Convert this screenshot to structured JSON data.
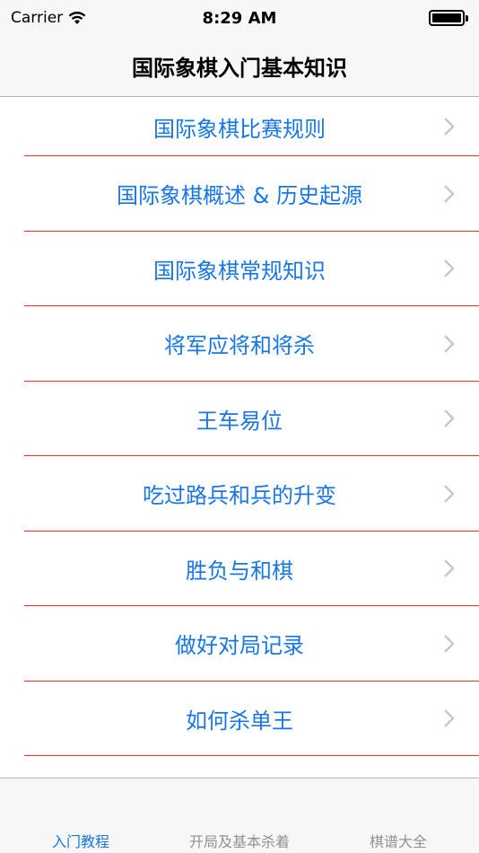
{
  "status_bar": {
    "carrier": "Carrier",
    "time": "8:29 AM"
  },
  "nav": {
    "title": "国际象棋入门基本知识"
  },
  "list": {
    "items": [
      {
        "label": "国际象棋比赛规则"
      },
      {
        "label": "国际象棋概述 & 历史起源"
      },
      {
        "label": "国际象棋常规知识"
      },
      {
        "label": "将军应将和将杀"
      },
      {
        "label": "王车易位"
      },
      {
        "label": "吃过路兵和兵的升变"
      },
      {
        "label": "胜负与和棋"
      },
      {
        "label": "做好对局记录"
      },
      {
        "label": "如何杀单王"
      }
    ]
  },
  "tabs": [
    {
      "label": "入门教程",
      "active": true
    },
    {
      "label": "开局及基本杀着",
      "active": false
    },
    {
      "label": "棋谱大全",
      "active": false
    }
  ],
  "colors": {
    "accent": "#1976e6",
    "separator": "#ff2a2a",
    "chevron": "#c7c7cc"
  }
}
